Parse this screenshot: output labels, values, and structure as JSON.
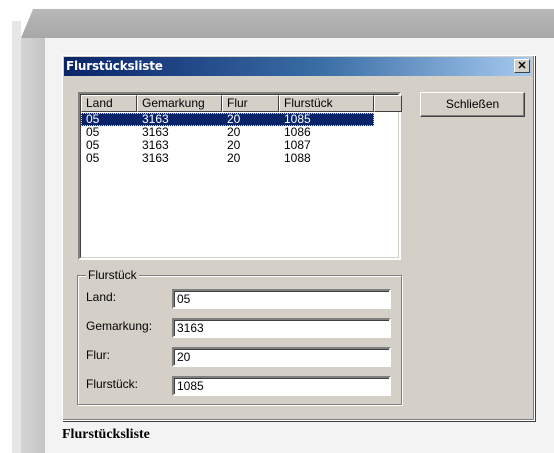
{
  "window": {
    "title": "Flurstücksliste",
    "close_glyph": "✕"
  },
  "list": {
    "columns": [
      "Land",
      "Gemarkung",
      "Flur",
      "Flurstück"
    ],
    "rows": [
      [
        "05",
        "3163",
        "20",
        "1085"
      ],
      [
        "05",
        "3163",
        "20",
        "1086"
      ],
      [
        "05",
        "3163",
        "20",
        "1087"
      ],
      [
        "05",
        "3163",
        "20",
        "1088"
      ]
    ],
    "selected_row": 0
  },
  "buttons": {
    "close_label": "Schließen"
  },
  "details": {
    "group_label": "Flurstück",
    "land_label": "Land:",
    "land_value": "05",
    "gemarkung_label": "Gemarkung:",
    "gemarkung_value": "3163",
    "flur_label": "Flur:",
    "flur_value": "20",
    "flurstueck_label": "Flurstück:",
    "flurstueck_value": "1085"
  },
  "caption": "Flurstücksliste",
  "colors": {
    "selection": "#0a246a",
    "titlebar_start": "#0a246a",
    "titlebar_end": "#a6caf0",
    "dialog_face": "#d4d0c8"
  }
}
